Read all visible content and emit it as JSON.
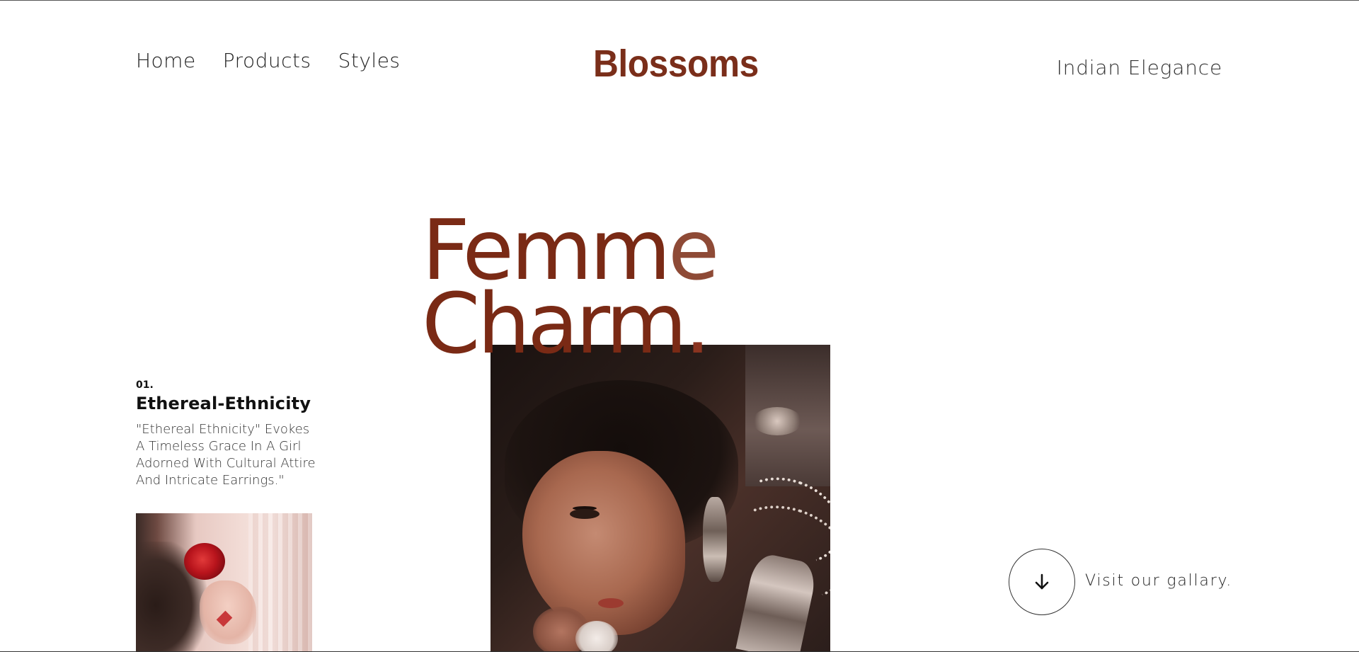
{
  "header": {
    "nav": [
      {
        "label": "Home"
      },
      {
        "label": "Products"
      },
      {
        "label": "Styles"
      }
    ],
    "brand": "Blossoms",
    "tagline": "Indian Elegance"
  },
  "hero": {
    "title_line1_a": "Femm",
    "title_line1_b": "e",
    "title_line2_a": "Charm",
    "title_line2_b": "."
  },
  "feature": {
    "number": "01.",
    "title": "Ethereal-Ethnicity",
    "description": "\"Ethereal Ethnicity\" Evokes A Timeless Grace In A Girl Adorned With Cultural Attire And Intricate Earrings.\""
  },
  "gallery": {
    "label": "Visit our gallary.",
    "icon": "arrow-down-icon"
  },
  "colors": {
    "brand": "#7a2e1a",
    "title": "#7a2a15"
  }
}
